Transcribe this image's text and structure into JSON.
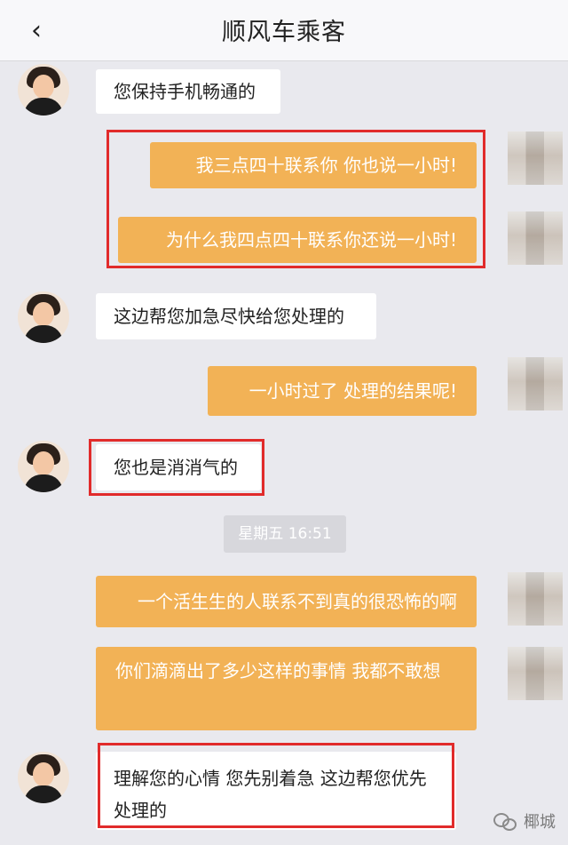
{
  "header": {
    "back_icon": "chevron-left-icon",
    "title": "顺风车乘客"
  },
  "messages": [
    {
      "side": "in",
      "text": "您保持手机畅通的"
    },
    {
      "side": "out",
      "text": "我三点四十联系你 你也说一小时!"
    },
    {
      "side": "out",
      "text": "为什么我四点四十联系你还说一小时!"
    },
    {
      "side": "in",
      "text": "这边帮您加急尽快给您处理的"
    },
    {
      "side": "out",
      "text": "一小时过了 处理的结果呢!"
    },
    {
      "side": "in",
      "text": "您也是消消气的"
    },
    {
      "side": "out",
      "text": "一个活生生的人联系不到真的很恐怖的啊"
    },
    {
      "side": "out",
      "text": "你们滴滴出了多少这样的事情 我都不敢想"
    },
    {
      "side": "in",
      "text": "理解您的心情 您先别着急 这边帮您优先处理的"
    }
  ],
  "timestamp": "星期五 16:51",
  "watermark": {
    "icon": "wechat-icon",
    "text": "椰城"
  },
  "colors": {
    "outgoing_bubble": "#f2b256",
    "incoming_bubble": "#ffffff",
    "highlight_box": "#e12b2b",
    "background": "#e9e9ee"
  }
}
